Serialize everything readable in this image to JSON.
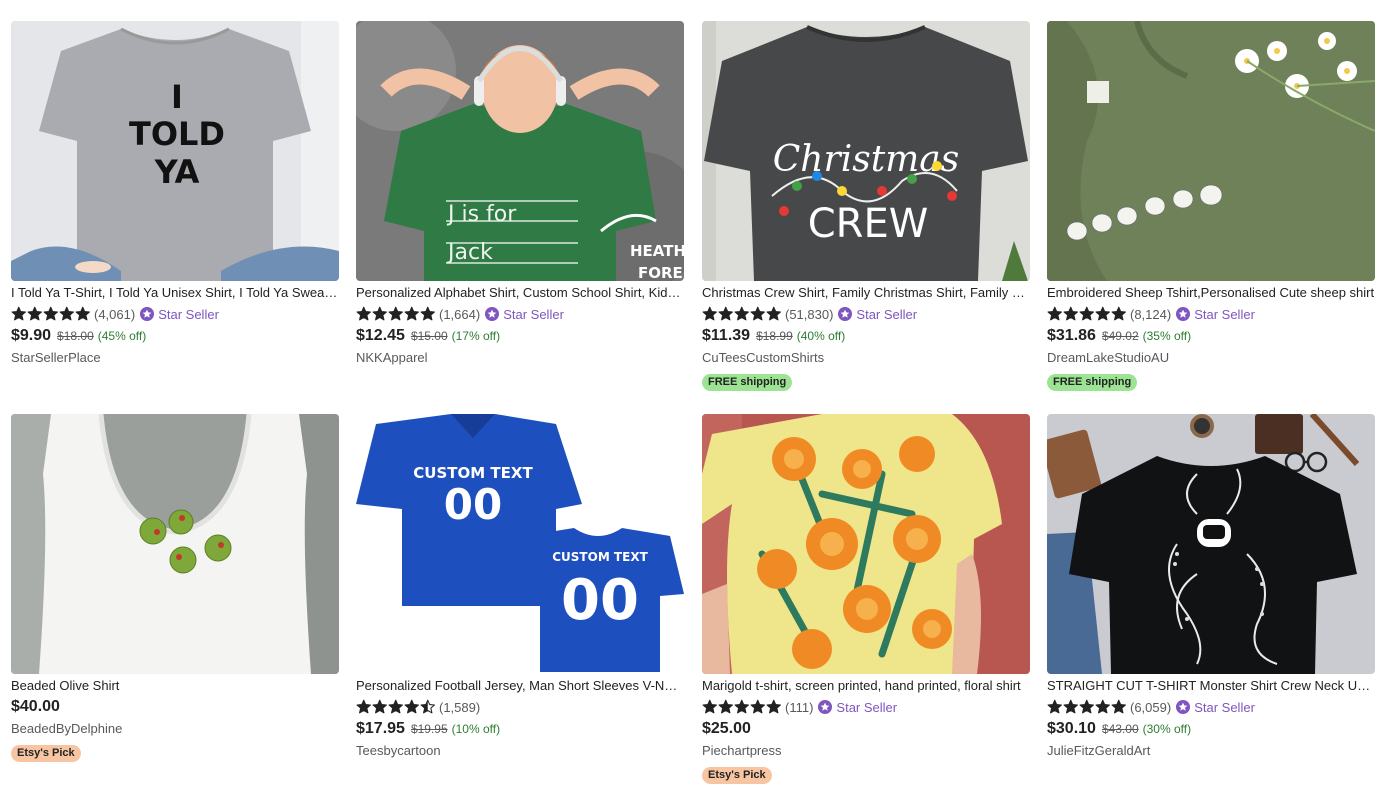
{
  "colors": {
    "star": "#222222",
    "star_seller": "#7f55bf",
    "discount": "#2e7d32",
    "free_shipping_bg": "#9de394",
    "etsys_pick_bg": "#f8c5a2"
  },
  "listings": [
    {
      "title": "I Told Ya T-Shirt, I Told Ya Unisex Shirt, I Told Ya Sweatshirt",
      "rating": 5,
      "review_count": "(4,061)",
      "star_seller": "Star Seller",
      "price": "$9.90",
      "original_price": "$18.00",
      "discount": "(45% off)",
      "shop": "StarSellerPlace",
      "image_text": [
        "I",
        "TOLD",
        "YA"
      ]
    },
    {
      "title": "Personalized Alphabet Shirt, Custom School Shirt, Kids Name Tee",
      "rating": 5,
      "review_count": "(1,664)",
      "star_seller": "Star Seller",
      "price": "$12.45",
      "original_price": "$15.00",
      "discount": "(17% off)",
      "shop": "NKKApparel",
      "image_text": [
        "J is for",
        "Jack",
        "HEATH",
        "FORE"
      ]
    },
    {
      "title": "Christmas Crew Shirt, Family Christmas Shirt, Family Matching Shirts",
      "rating": 5,
      "review_count": "(51,830)",
      "star_seller": "Star Seller",
      "price": "$11.39",
      "original_price": "$18.99",
      "discount": "(40% off)",
      "shop": "CuTeesCustomShirts",
      "badge": "FREE shipping",
      "image_text": [
        "Christmas",
        "CREW"
      ]
    },
    {
      "title": "Embroidered Sheep Tshirt,Personalised Cute sheep shirt",
      "rating": 5,
      "review_count": "(8,124)",
      "star_seller": "Star Seller",
      "price": "$31.86",
      "original_price": "$49.02",
      "discount": "(35% off)",
      "shop": "DreamLakeStudioAU",
      "badge": "FREE shipping"
    },
    {
      "title": "Beaded Olive Shirt",
      "price": "$40.00",
      "shop": "BeadedByDelphine",
      "badge": "Etsy's Pick"
    },
    {
      "title": "Personalized Football Jersey, Man Short Sleeves V-Neck Jersey",
      "rating": 4.5,
      "review_count": "(1,589)",
      "price": "$17.95",
      "original_price": "$19.95",
      "discount": "(10% off)",
      "shop": "Teesbycartoon",
      "image_text": [
        "CUSTOM TEXT",
        "00"
      ]
    },
    {
      "title": "Marigold t-shirt, screen printed, hand printed, floral shirt",
      "rating": 5,
      "review_count": "(111)",
      "star_seller": "Star Seller",
      "price": "$25.00",
      "shop": "Piechartpress",
      "badge": "Etsy's Pick"
    },
    {
      "title": "STRAIGHT CUT T-SHIRT Monster Shirt Crew Neck Unisex Tee",
      "rating": 5,
      "review_count": "(6,059)",
      "star_seller": "Star Seller",
      "price": "$30.10",
      "original_price": "$43.00",
      "discount": "(30% off)",
      "shop": "JulieFitzGeraldArt"
    }
  ]
}
